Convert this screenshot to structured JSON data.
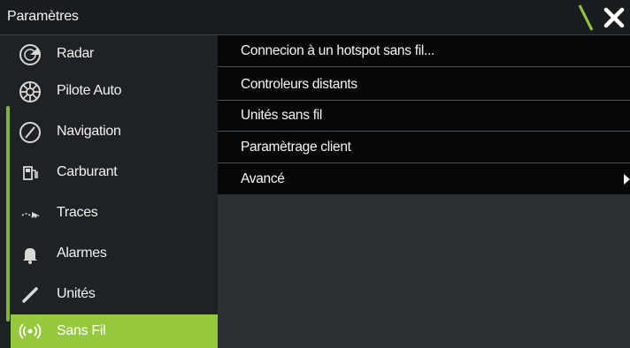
{
  "window": {
    "title": "Paramètres"
  },
  "sidebar": {
    "items": [
      {
        "label": "Radar",
        "icon": "radar-icon"
      },
      {
        "label": "Pilote Auto",
        "icon": "helm-wheel-icon"
      },
      {
        "label": "Navigation",
        "icon": "compass-icon"
      },
      {
        "label": "Carburant",
        "icon": "fuel-pump-icon"
      },
      {
        "label": "Traces",
        "icon": "track-icon"
      },
      {
        "label": "Alarmes",
        "icon": "bell-icon"
      },
      {
        "label": "Unités",
        "icon": "ruler-icon"
      },
      {
        "label": "Sans Fil",
        "icon": "wireless-icon"
      }
    ],
    "selected": "Sans Fil"
  },
  "menu": {
    "items": [
      {
        "label": "Connecion à un hotspot sans fil..."
      },
      {
        "label": "Controleurs distants"
      },
      {
        "label": "Unités sans fil"
      },
      {
        "label": "Paramètrage client"
      },
      {
        "label": "Avancé",
        "has_submenu": true
      }
    ]
  },
  "colors": {
    "accent": "#94c83d",
    "sidebar_bg": "#1e2225",
    "menu_bg": "#060708",
    "titlebar_bg": "#1a1d1f"
  }
}
